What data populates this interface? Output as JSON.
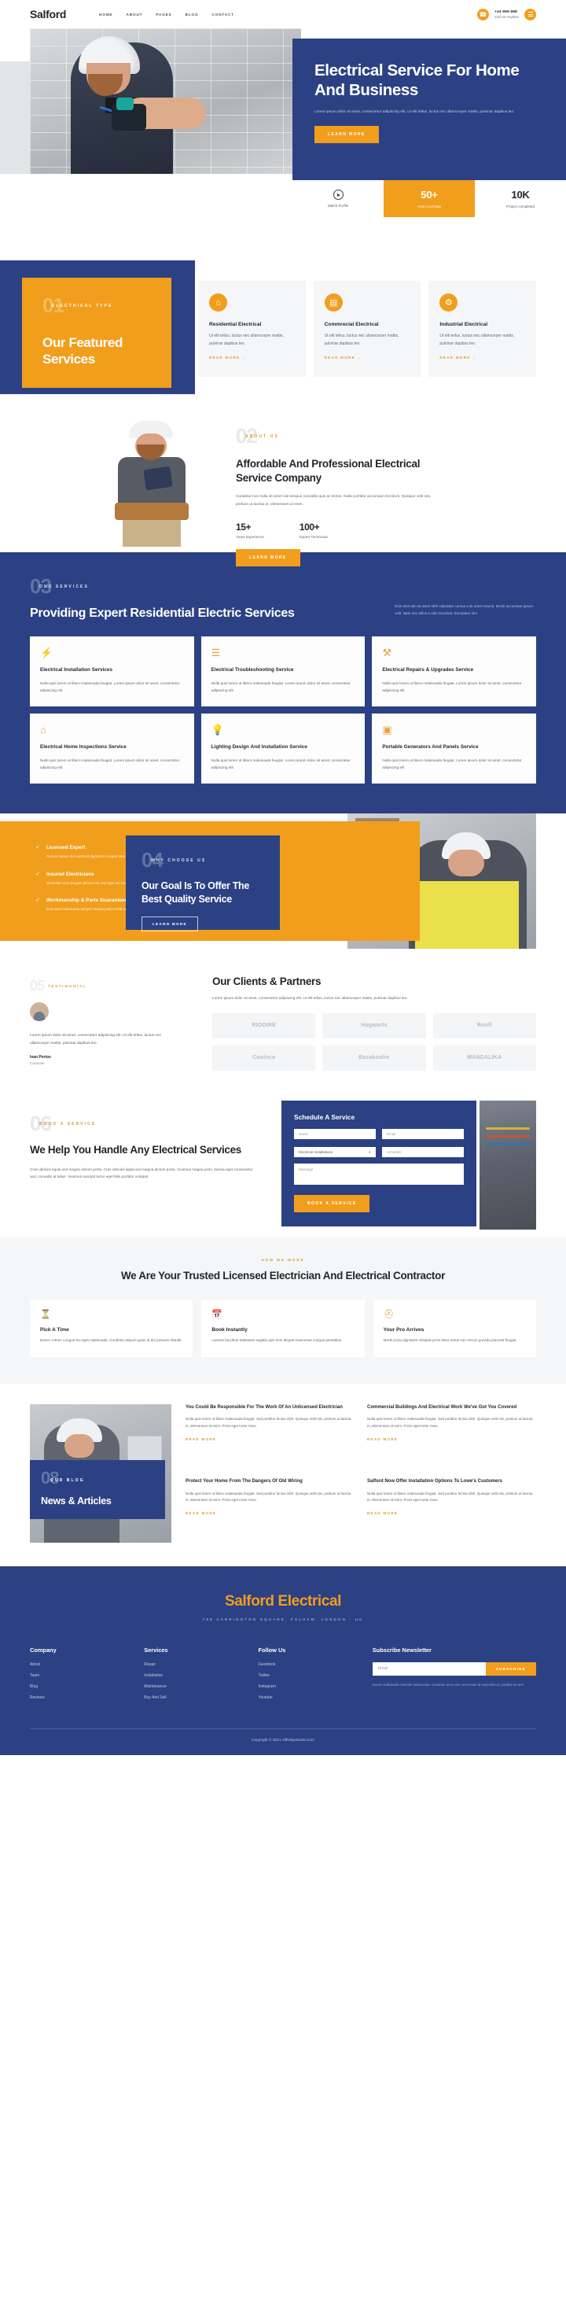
{
  "header": {
    "logo": "Salford",
    "nav": [
      "HOME",
      "ABOUT",
      "PAGES",
      "BLOG",
      "CONTACT"
    ],
    "phone_number": "+44 999 888",
    "phone_label": "Call Us Anytime",
    "phone_icon": "phone-icon",
    "menu_icon": "hamburger-icon"
  },
  "hero": {
    "title": "Electrical Service For Home And Business",
    "paragraph": "Lorem ipsum dolor sit amet, consectetur adipiscing elit. Ut elit tellus, luctus nec ullamcorper mattis, pulvinar dapibus leo.",
    "cta": "LEARN MORE",
    "stats": [
      {
        "icon": "play-icon",
        "value": "",
        "label": "Watch Profile",
        "highlight": false
      },
      {
        "icon": "",
        "value": "50+",
        "label": "Area Coverage",
        "highlight": true
      },
      {
        "icon": "",
        "value": "10K",
        "label": "Project completed",
        "highlight": false
      }
    ]
  },
  "featured": {
    "number": "01",
    "eyebrow": "ELECTRICAL TYPE",
    "title": "Our Featured Services",
    "cards": [
      {
        "icon": "house-icon",
        "glyph": "⌂",
        "title": "Residential Electrical",
        "text": "Ut elit tellus, luctus nec ullamcorper mattis, pulvinar dapibus leo.",
        "link": "READ MORE →"
      },
      {
        "icon": "building-icon",
        "glyph": "▤",
        "title": "Commrecial Electrical",
        "text": "Ut elit tellus, luctus nec ullamcorper mattis, pulvinar dapibus leo.",
        "link": "READ MORE →"
      },
      {
        "icon": "gear-icon",
        "glyph": "⚙",
        "title": "Industrial Electrical",
        "text": "Ut elit tellus, luctus nec ullamcorper mattis, pulvinar dapibus leo.",
        "link": "READ MORE →"
      }
    ]
  },
  "about": {
    "number": "02",
    "eyebrow": "ABOUT US",
    "title": "Affordable And Professional Electrical Service Company",
    "paragraph": "Curabitur non nulla sit amet nisl tempus convallis quis ac lectus. Nulla porttitor accumsan tincidunt. Quisque velit nisi, pretium ut lacinia in, elementum id enim.",
    "stats": [
      {
        "value": "15+",
        "label": "Years Experience"
      },
      {
        "value": "100+",
        "label": "Expert Technician"
      }
    ],
    "cta": "LEARN MORE"
  },
  "services": {
    "number": "03",
    "eyebrow": "OUR SERVICES",
    "title": "Providing Expert Residential Electric Services",
    "paragraph": "Duis sed odio sit amet nibh vulputate cursus a sit amet mauris. Morbi accumsan ipsum velit. Nam nec tellus a odio tincidunt. Excepteur sint",
    "cards": [
      {
        "icon": "bolt-icon",
        "glyph": "⚡",
        "title": "Electrical Installation Services",
        "text": "Nulla quis lorem ut libero malesuada feugiat. Lorem ipsum dolor sit amet, consectetur adipiscing elit"
      },
      {
        "icon": "layers-icon",
        "glyph": "≡",
        "title": "Electrical Troubleshooting Service",
        "text": "Nulla quis lorem ut libero malesuada feugiat. Lorem ipsum dolor sit amet, consectetur adipiscing elit"
      },
      {
        "icon": "tools-icon",
        "glyph": "⚒",
        "title": "Electrical Repairs & Upgrades Service",
        "text": "Nulla quis lorem ut libero malesuada feugiat. Lorem ipsum dolor sit amet, consectetur adipiscing elit"
      },
      {
        "icon": "home-icon",
        "glyph": "⌂",
        "title": "Electrical Home Inspections Service",
        "text": "Nulla quis lorem ut libero malesuada feugiat. Lorem ipsum dolor sit amet, consectetur adipiscing elit"
      },
      {
        "icon": "bulb-icon",
        "glyph": "Ὂ1",
        "title": "Lighting Design And Installation Service",
        "text": "Nulla quis lorem ut libero malesuada feugiat. Lorem ipsum dolor sit amet, consectetur adipiscing elit"
      },
      {
        "icon": "panel-icon",
        "glyph": "▣",
        "title": "Portable Generators And Panels Service",
        "text": "Nulla quis lorem ut libero malesuada feugiat. Lorem ipsum dolor sit amet, consectetur adipiscing elit"
      }
    ]
  },
  "choose": {
    "number": "04",
    "eyebrow": "WHY CHOOSE US",
    "title": "Our Goal Is To Offer The Best Quality Service",
    "cta": "LEARN MORE",
    "items": [
      {
        "icon": "check-icon",
        "title": "Licensed Expert",
        "text": "Cursus sapien dui euismod dignissim congue ante nostra lobortis"
      },
      {
        "icon": "check-icon",
        "title": "Insured Electricians",
        "text": "Venenatis eros feugiat ultrices dui erat eget vel sociosqu euismod integer"
      },
      {
        "icon": "check-icon",
        "title": "Workmanship & Parts Guaranteed",
        "text": "Erat risus malesuada semper massa justo morbi vehicula aliquam"
      }
    ]
  },
  "clients": {
    "number": "05",
    "eyebrow": "TESTIMONIAL",
    "quote": "Lorem ipsum dolor sit amet, consectetur adipiscing elit. Ut elit tellus, luctus nec ullamcorper mattis, pulvinar dapibus leo.",
    "author": "Ivan Pertov",
    "author_role": "Customer",
    "title": "Our Clients & Partners",
    "paragraph": "Lorem ipsum dolor sit amet, consectetur adipiscing elit. Ut elit tellus, luctus nec ullamcorper mattis, pulvinar dapibus leo.",
    "logos": [
      "RIODIRE",
      "Hogwarts",
      "Roofi",
      "Coolnco",
      "Basakoshir",
      "MANDALIKA"
    ]
  },
  "book": {
    "number": "06",
    "eyebrow": "BOOK A SERVICE",
    "title": "We Help You Handle Any Electrical Services",
    "paragraph": "Cras ultricies ligula sed magna dictum porta. Cras ultricies ligula sed magna dictum porta. Vivamus magna justo, lacinia eget consectetur sed, convallis at tellus. Vivamus suscipit tortor eget felis porttitor volutpat",
    "form": {
      "heading": "Schedule A Service",
      "name_placeholder": "Name",
      "email_placeholder": "Email",
      "service_value": "Electrical Installations",
      "schedule_placeholder": "Schedule",
      "message_placeholder": "Message",
      "submit": "BOOK A SERVICE"
    }
  },
  "trusted": {
    "eyebrow": "HOW WE WORK",
    "title": "We Are Your Trusted Licensed Electrician And Electrical Contractor",
    "cards": [
      {
        "icon": "clock-icon",
        "glyph": "⌚",
        "title": "Pick A Time",
        "text": "Donec rutrum congue leo eget malesuada. Curabitur aliquet quam id dui posuere blandit"
      },
      {
        "icon": "calendar-icon",
        "glyph": "Ὄ5",
        "title": "Book Instantly",
        "text": "Laoreet faucibus habitasse sagittis quis sem aliquet maecenas congue penatibus"
      },
      {
        "icon": "truck-icon",
        "glyph": "⛑",
        "title": "Your Pro Arrives",
        "text": "Morbi porta dignissim volutpat proin litora netus non rutrum gravida placerat feugiat"
      }
    ]
  },
  "news": {
    "number": "08",
    "eyebrow": "OUR BLOG",
    "title": "News & Articles",
    "articles": [
      {
        "title": "You Could Be Responsible For The Work Of An Unlicensed Electrician",
        "text": "Nulla quis lorem ut libero malesuada feugiat. Sed porttitor lectus nibh. Quisque velit nisi, pretium ut lacinia in, elementum id enim. Proin eget tortor risus.",
        "link": "READ MORE"
      },
      {
        "title": "Commercial Buildings And Electrical Work We've Got You Covered",
        "text": "Nulla quis lorem ut libero malesuada feugiat. Sed porttitor lectus nibh. Quisque velit nisi, pretium ut lacinia in, elementum id enim. Proin eget tortor risus.",
        "link": "READ MORE"
      },
      {
        "title": "Protect Your Home From The Dangers Of Old Wiring",
        "text": "Nulla quis lorem ut libero malesuada feugiat. Sed porttitor lectus nibh. Quisque velit nisi, pretium ut lacinia in, elementum id enim. Proin eget tortor risus.",
        "link": "READ MORE"
      },
      {
        "title": "Salford Now Offer Installation Options To Lowe's Customers",
        "text": "Nulla quis lorem ut libero malesuada feugiat. Sed porttitor lectus nibh. Quisque velit nisi, pretium ut lacinia in, elementum id enim. Proin eget tortor risus.",
        "link": "READ MORE"
      }
    ]
  },
  "footer": {
    "logo_main": "Salford",
    "logo_accent": "Electrical",
    "address": "789 CARRINGTON SQUARE, FULHAM, LONDON - UK",
    "columns": [
      {
        "heading": "Company",
        "links": [
          "About",
          "Team",
          "Blog",
          "Reviews"
        ]
      },
      {
        "heading": "Services",
        "links": [
          "Repair",
          "Installation",
          "Maintenance",
          "Buy And Sell"
        ]
      },
      {
        "heading": "Follow Us",
        "links": [
          "Facebook",
          "Twitter",
          "Instagram",
          "Youtube"
        ]
      }
    ],
    "newsletter": {
      "heading": "Subscribe Newsletter",
      "placeholder": "Email",
      "button": "SUBSCRIBE",
      "note": "Donec sollicitudin molestie malesuada. Curabitur arcu erat, accumsan id imperdiet et, porttitor at sem"
    },
    "copyright": "Copyright © 2021 Allfridaystudio.Com"
  },
  "colors": {
    "blue": "#2c4184",
    "orange": "#f19e1d",
    "dark": "#24262d"
  }
}
